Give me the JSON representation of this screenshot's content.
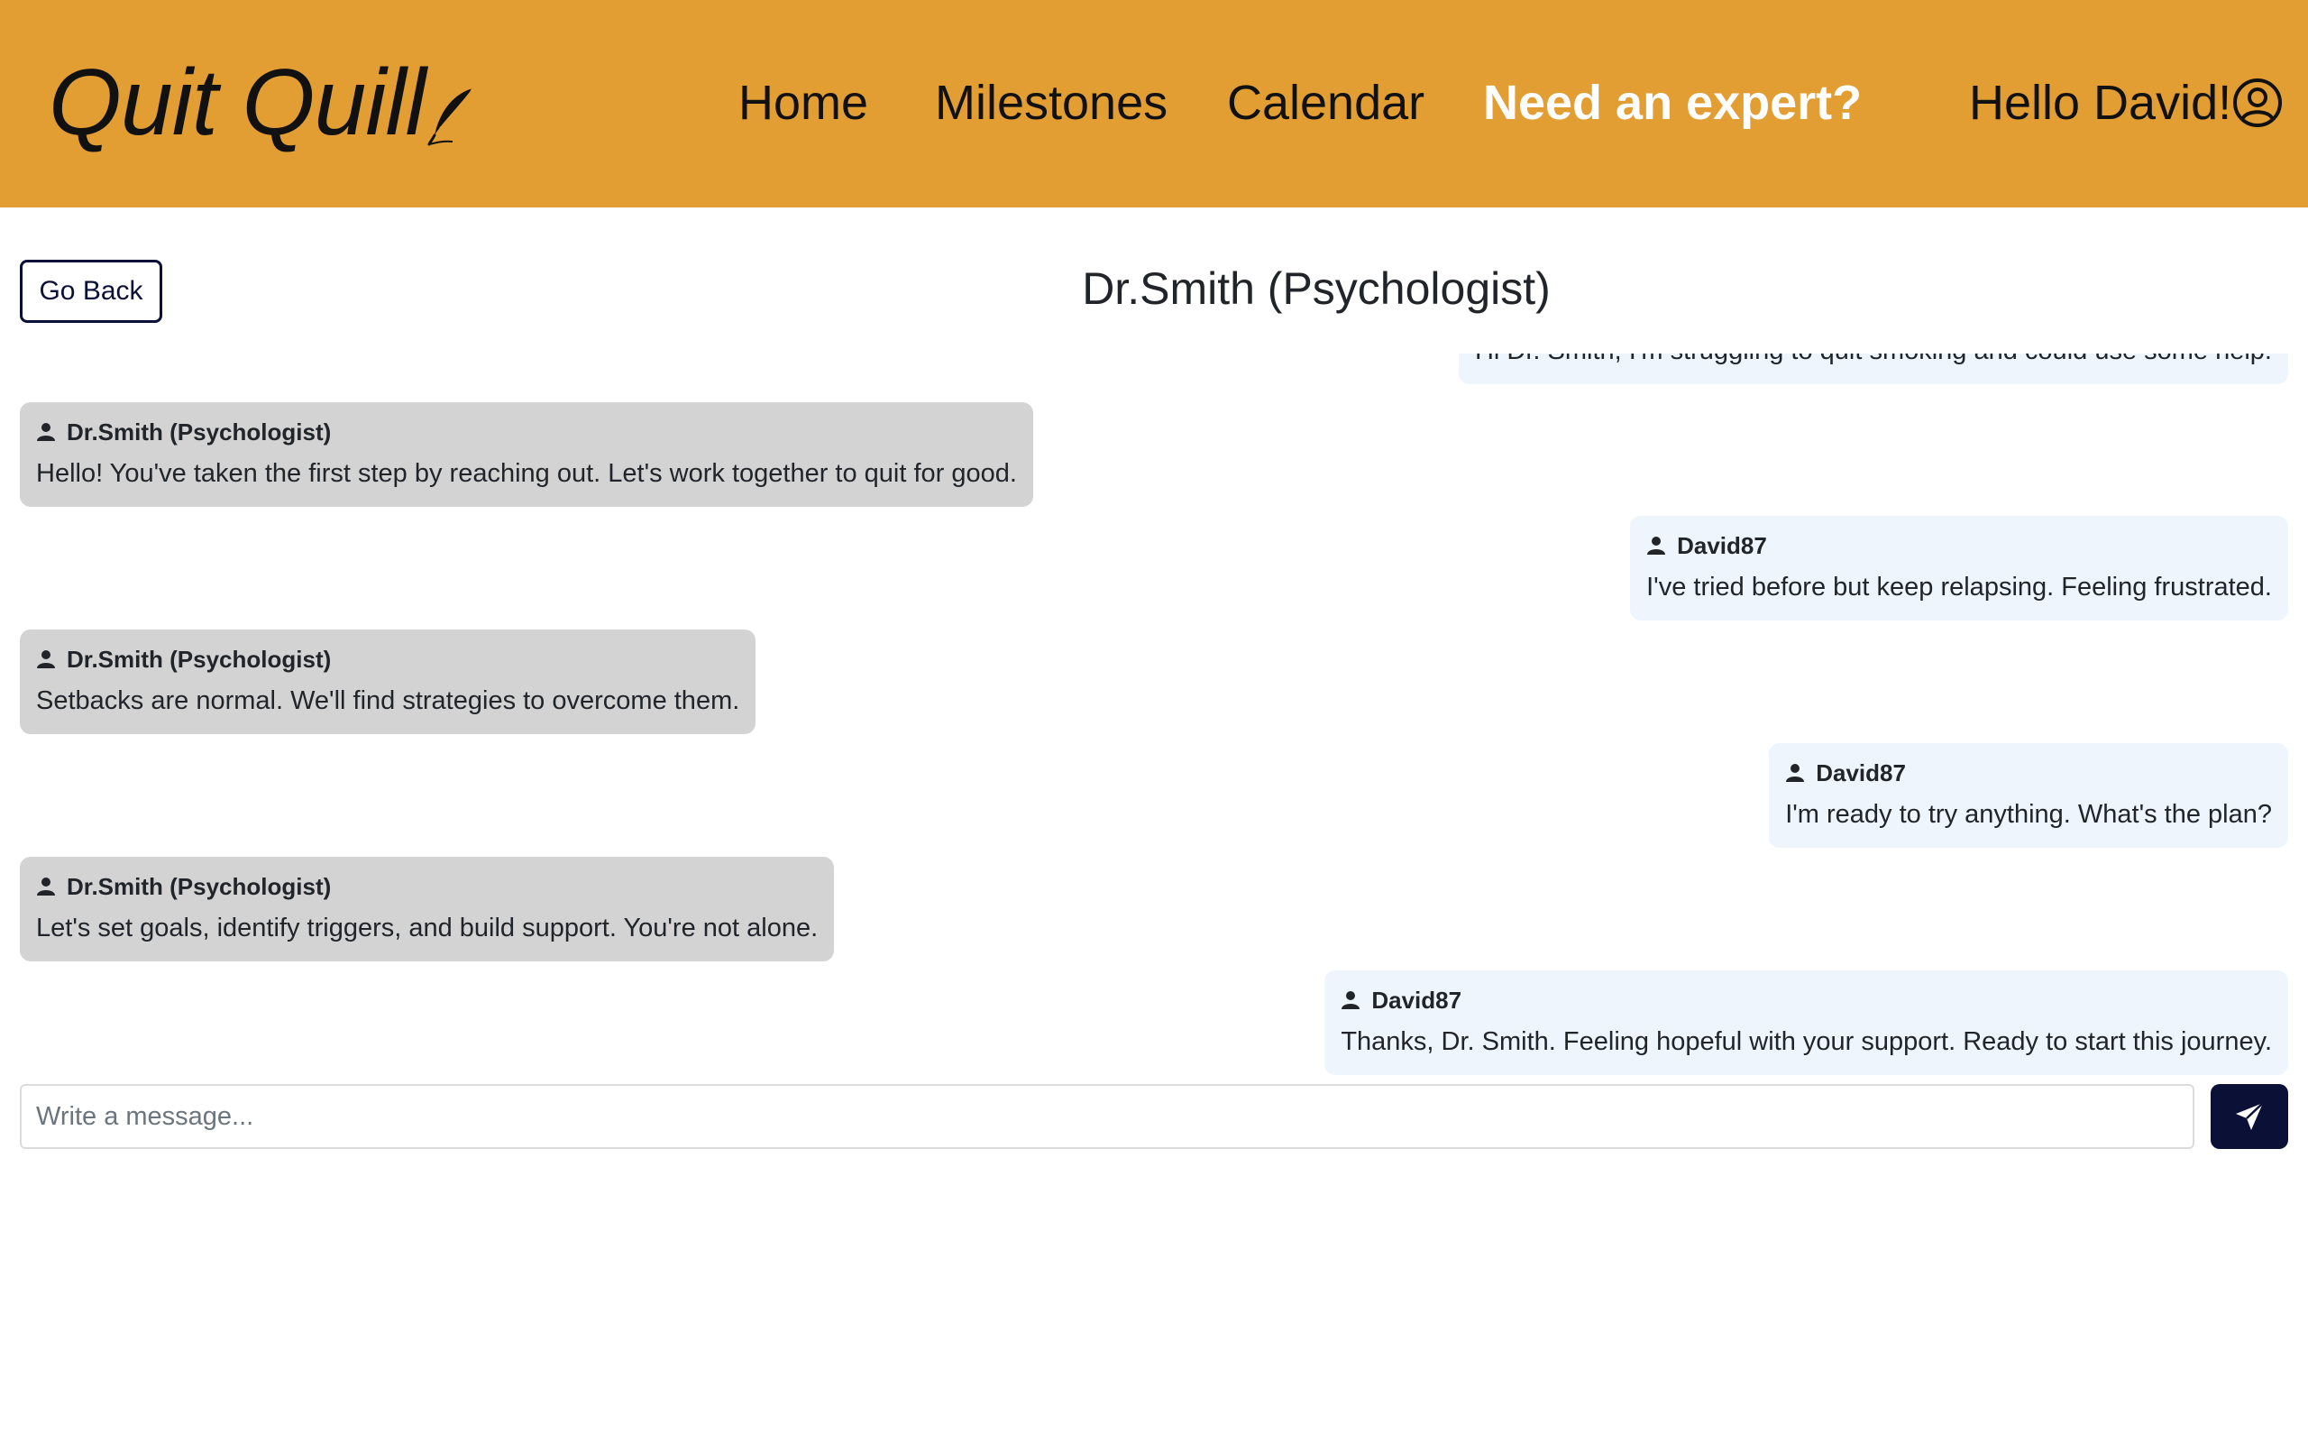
{
  "header": {
    "brand": "Quit Quill",
    "brand_icon": "quill-icon",
    "nav": [
      {
        "label": "Home",
        "active": false
      },
      {
        "label": "Milestones",
        "active": false
      },
      {
        "label": "Calendar",
        "active": false
      },
      {
        "label": "Need an expert?",
        "active": true
      }
    ],
    "greeting": "Hello David!",
    "avatar_icon": "user-circle-icon",
    "background_color": "#e29e33"
  },
  "chat": {
    "back_label": "Go Back",
    "title": "Dr.Smith (Psychologist)",
    "messages": [
      {
        "from": "user",
        "sender": "",
        "text": "Hi Dr. Smith, I'm struggling to quit smoking and could use some help."
      },
      {
        "from": "doctor",
        "sender": "Dr.Smith (Psychologist)",
        "text": "Hello! You've taken the first step by reaching out. Let's work together to quit for good."
      },
      {
        "from": "user",
        "sender": "David87",
        "text": "I've tried before but keep relapsing. Feeling frustrated."
      },
      {
        "from": "doctor",
        "sender": "Dr.Smith (Psychologist)",
        "text": "Setbacks are normal. We'll find strategies to overcome them."
      },
      {
        "from": "user",
        "sender": "David87",
        "text": "I'm ready to try anything. What's the plan?"
      },
      {
        "from": "doctor",
        "sender": "Dr.Smith (Psychologist)",
        "text": "Let's set goals, identify triggers, and build support. You're not alone."
      },
      {
        "from": "user",
        "sender": "David87",
        "text": "Thanks, Dr. Smith. Feeling hopeful with your support. Ready to start this journey."
      }
    ],
    "doctor_bubble_color": "#d3d3d3",
    "user_bubble_color": "#eef5fd"
  },
  "composer": {
    "placeholder": "Write a message...",
    "value": "",
    "send_icon": "send-icon",
    "send_color": "#0b1136"
  }
}
